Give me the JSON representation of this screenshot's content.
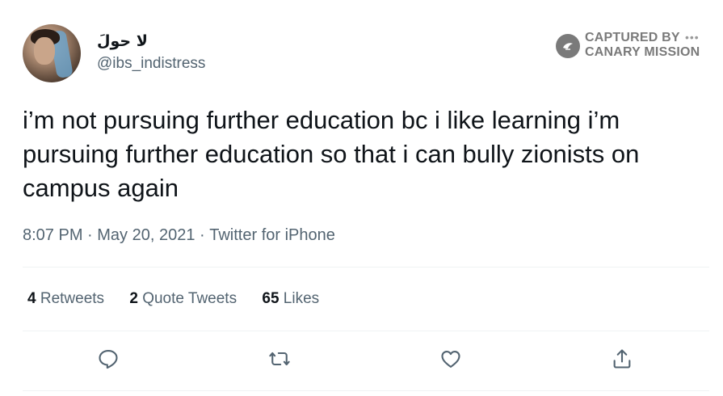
{
  "user": {
    "display_name": "لا حولَ",
    "handle": "@ibs_indistress"
  },
  "watermark": {
    "line1": "CAPTURED BY",
    "line2": "CANARY MISSION",
    "dots": "•••"
  },
  "tweet": {
    "text": "i’m not pursuing further education bc i like learning i’m pursuing further education so that i can bully zionists on campus again",
    "time": "8:07 PM",
    "separator1": " · ",
    "date": "May 20, 2021",
    "separator2": " · ",
    "source": "Twitter for iPhone"
  },
  "stats": {
    "retweets_count": "4",
    "retweets_label": " Retweets",
    "quotes_count": "2",
    "quotes_label": " Quote Tweets",
    "likes_count": "65",
    "likes_label": " Likes"
  },
  "icons": {
    "reply": "reply-icon",
    "retweet": "retweet-icon",
    "like": "heart-icon",
    "share": "share-icon",
    "watermark": "bird-badge-icon"
  },
  "colors": {
    "text": "#0f1419",
    "secondary": "#536471",
    "divider": "#eff3f4",
    "watermark": "#7a7a7a"
  }
}
